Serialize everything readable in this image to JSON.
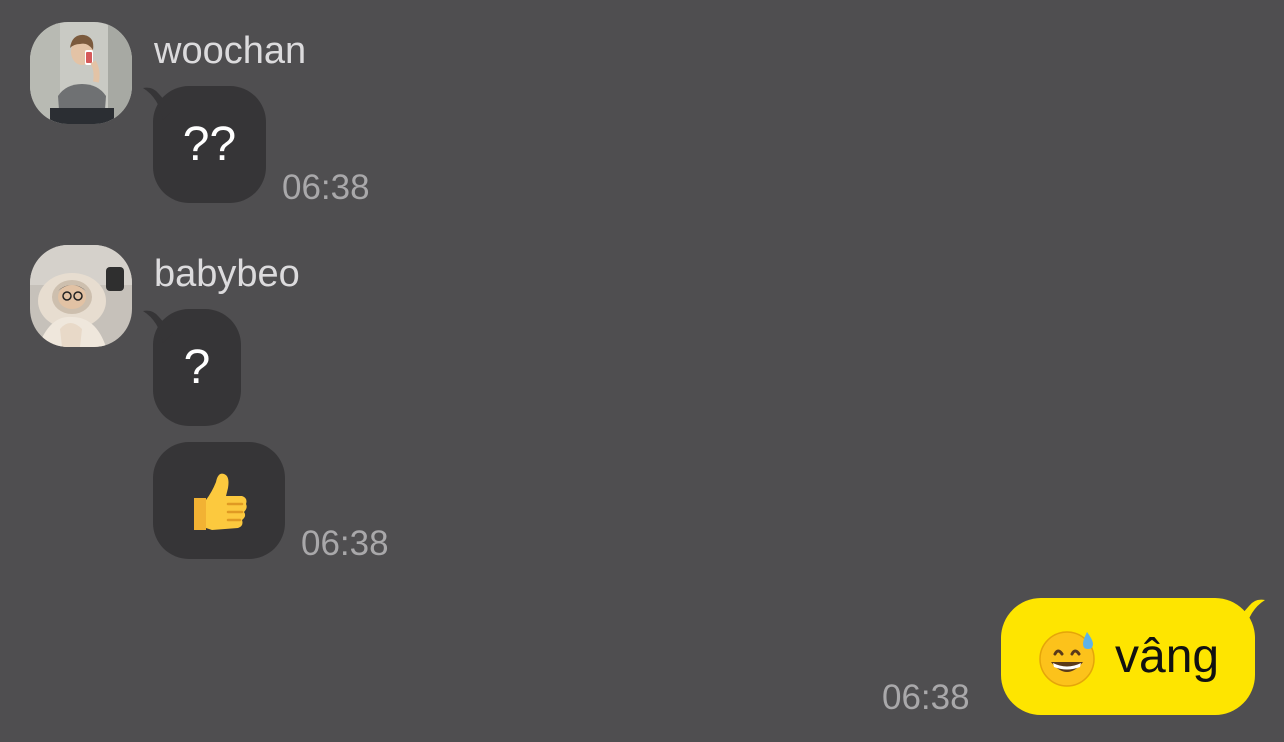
{
  "messages": [
    {
      "sender": "woochan",
      "avatar_icon": "profile-photo-woochan",
      "bubbles": [
        {
          "text": "??"
        }
      ],
      "time": "06:38"
    },
    {
      "sender": "babybeo",
      "avatar_icon": "profile-photo-babybeo",
      "bubbles": [
        {
          "text": "?"
        },
        {
          "emoji": "thumbs-up-icon"
        }
      ],
      "time": "06:38"
    }
  ],
  "my_message": {
    "emoji": "grinning-sweat-face-icon",
    "text": "vâng",
    "time": "06:38"
  },
  "colors": {
    "background": "#4f4e50",
    "incoming_bubble": "#363537",
    "outgoing_bubble": "#fee500"
  }
}
